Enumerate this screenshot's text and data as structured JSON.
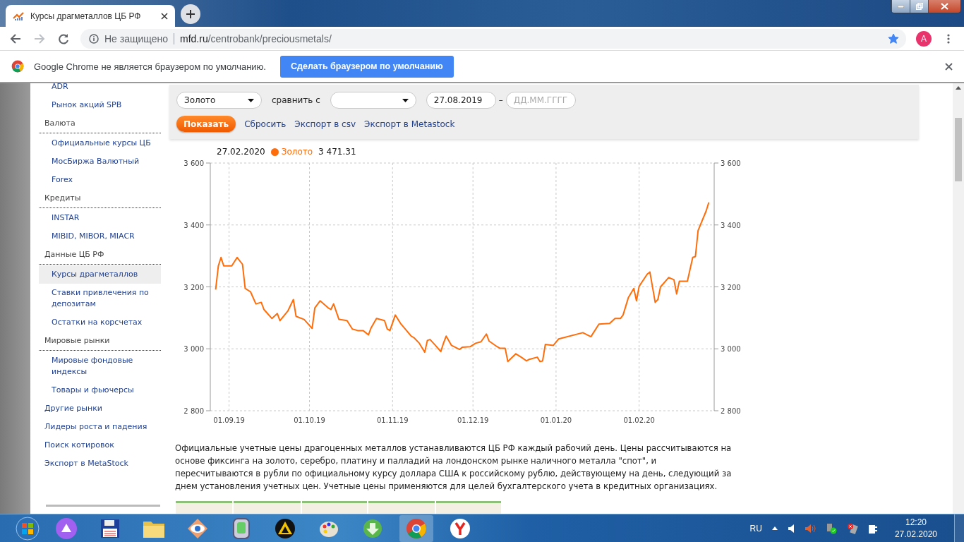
{
  "browser": {
    "tab_title": "Курсы драгметаллов ЦБ РФ",
    "security": "Не защищено",
    "url_host": "mfd.ru",
    "url_path": "/centrobank/preciousmetals/",
    "bookmarked": true,
    "profile_initial": "A"
  },
  "infobar": {
    "message": "Google Chrome не является браузером по умолчанию.",
    "button": "Сделать браузером по умолчанию"
  },
  "sidebar": {
    "items": [
      {
        "kind": "sub",
        "label": "ADR",
        "selected": false
      },
      {
        "kind": "sub",
        "label": "Рынок акций SPB",
        "selected": false
      },
      {
        "kind": "section",
        "label": "Валюта",
        "selected": false
      },
      {
        "kind": "sub",
        "label": "Официальные курсы ЦБ",
        "selected": false
      },
      {
        "kind": "sub",
        "label": "МосБиржа Валютный",
        "selected": false
      },
      {
        "kind": "sub",
        "label": "Forex",
        "selected": false
      },
      {
        "kind": "section",
        "label": "Кредиты",
        "selected": false
      },
      {
        "kind": "sub",
        "label": "INSTAR",
        "selected": false
      },
      {
        "kind": "sub",
        "label": "MIBID, MIBOR, MIACR",
        "selected": false
      },
      {
        "kind": "section",
        "label": "Данные ЦБ РФ",
        "selected": false
      },
      {
        "kind": "sub",
        "label": "Курсы драгметаллов",
        "selected": true
      },
      {
        "kind": "sub",
        "label": "Ставки привлечения по депозитам",
        "selected": false
      },
      {
        "kind": "sub",
        "label": "Остатки на корсчетах",
        "selected": false
      },
      {
        "kind": "section",
        "label": "Мировые рынки",
        "selected": false
      },
      {
        "kind": "sub",
        "label": "Мировые фондовые индексы",
        "selected": false
      },
      {
        "kind": "sub",
        "label": "Товары и фьючерсы",
        "selected": false
      },
      {
        "kind": "top",
        "label": "Другие рынки",
        "selected": false
      },
      {
        "kind": "top",
        "label": "Лидеры роста и падения",
        "selected": false
      },
      {
        "kind": "top",
        "label": "Поиск котировок",
        "selected": false
      },
      {
        "kind": "top",
        "label": "Экспорт в MetaStock",
        "selected": false
      }
    ]
  },
  "filters": {
    "metal": "Золото",
    "compare_label": "сравнить с",
    "date_from": "27.08.2019",
    "date_separator": "–",
    "date_to_placeholder": "ДД.ММ.ГГГГ",
    "show_button": "Показать",
    "links": [
      "Сбросить",
      "Экспорт в csv",
      "Экспорт в Metastock"
    ]
  },
  "legend": {
    "date": "27.02.2020",
    "value": "3 471.31"
  },
  "chart_data": {
    "type": "line",
    "grid": true,
    "xlim": [
      "2019-08-25",
      "2020-02-29"
    ],
    "ylim": [
      2800,
      3600
    ],
    "y2lim": [
      2800,
      3600
    ],
    "xticks": [
      {
        "value": "2019-09-01",
        "label": "01.09.19"
      },
      {
        "value": "2019-10-01",
        "label": "01.10.19"
      },
      {
        "value": "2019-11-01",
        "label": "01.11.19"
      },
      {
        "value": "2019-12-01",
        "label": "01.12.19"
      },
      {
        "value": "2020-01-01",
        "label": "01.01.20"
      },
      {
        "value": "2020-02-01",
        "label": "01.02.20"
      }
    ],
    "yticks": [
      {
        "value": 2800,
        "label": "2 800"
      },
      {
        "value": 3000,
        "label": "3 000"
      },
      {
        "value": 3200,
        "label": "3 200"
      },
      {
        "value": 3400,
        "label": "3 400"
      },
      {
        "value": 3600,
        "label": "3 600"
      }
    ],
    "y2ticks": [
      {
        "value": 2800,
        "label": "2 800"
      },
      {
        "value": 3000,
        "label": "3 000"
      },
      {
        "value": 3200,
        "label": "3 200"
      },
      {
        "value": 3400,
        "label": "3 400"
      },
      {
        "value": 3600,
        "label": "3 600"
      }
    ],
    "x": [
      "2019-08-27",
      "2019-08-28",
      "2019-08-29",
      "2019-08-30",
      "2019-09-02",
      "2019-09-04",
      "2019-09-06",
      "2019-09-07",
      "2019-09-09",
      "2019-09-11",
      "2019-09-13",
      "2019-09-14",
      "2019-09-17",
      "2019-09-19",
      "2019-09-20",
      "2019-09-23",
      "2019-09-25",
      "2019-09-26",
      "2019-09-29",
      "2019-10-02",
      "2019-10-03",
      "2019-10-05",
      "2019-10-08",
      "2019-10-09",
      "2019-10-10",
      "2019-10-12",
      "2019-10-15",
      "2019-10-17",
      "2019-10-19",
      "2019-10-21",
      "2019-10-23",
      "2019-10-24",
      "2019-10-26",
      "2019-10-29",
      "2019-10-30",
      "2019-10-31",
      "2019-11-02",
      "2019-11-04",
      "2019-11-08",
      "2019-11-09",
      "2019-11-11",
      "2019-11-13",
      "2019-11-14",
      "2019-11-15",
      "2019-11-17",
      "2019-11-19",
      "2019-11-20",
      "2019-11-21",
      "2019-11-23",
      "2019-11-26",
      "2019-11-27",
      "2019-11-30",
      "2019-12-02",
      "2019-12-04",
      "2019-12-06",
      "2019-12-07",
      "2019-12-10",
      "2019-12-11",
      "2019-12-13",
      "2019-12-14",
      "2019-12-17",
      "2019-12-19",
      "2019-12-21",
      "2019-12-22",
      "2019-12-25",
      "2019-12-26",
      "2019-12-27",
      "2019-12-28",
      "2019-12-31",
      "2020-01-02",
      "2020-01-11",
      "2020-01-14",
      "2020-01-17",
      "2020-01-21",
      "2020-01-23",
      "2020-01-25",
      "2020-01-26",
      "2020-01-28",
      "2020-01-30",
      "2020-01-31",
      "2020-02-01",
      "2020-02-04",
      "2020-02-05",
      "2020-02-07",
      "2020-02-08",
      "2020-02-09",
      "2020-02-12",
      "2020-02-14",
      "2020-02-15",
      "2020-02-16",
      "2020-02-18",
      "2020-02-19",
      "2020-02-21",
      "2020-02-22",
      "2020-02-23",
      "2020-02-26",
      "2020-02-27"
    ],
    "series": [
      {
        "name": "Золото",
        "color": "#ff6d0a",
        "values": [
          3191,
          3268,
          3295,
          3268,
          3268,
          3295,
          3273,
          3195,
          3184,
          3145,
          3150,
          3127,
          3098,
          3114,
          3091,
          3123,
          3159,
          3105,
          3095,
          3066,
          3132,
          3155,
          3132,
          3127,
          3145,
          3095,
          3091,
          3064,
          3059,
          3059,
          3045,
          3068,
          3098,
          3091,
          3064,
          3059,
          3109,
          3082,
          3041,
          3036,
          3018,
          2989,
          3027,
          3030,
          3011,
          2991,
          3018,
          3041,
          3011,
          2998,
          3005,
          3007,
          3018,
          3023,
          3048,
          3025,
          3007,
          3002,
          3002,
          2959,
          2984,
          2973,
          2961,
          2966,
          2973,
          2959,
          2961,
          3014,
          3011,
          3032,
          3052,
          3039,
          3080,
          3082,
          3098,
          3098,
          3109,
          3166,
          3195,
          3155,
          3202,
          3241,
          3248,
          3150,
          3159,
          3200,
          3230,
          3223,
          3177,
          3218,
          3218,
          3218,
          3295,
          3298,
          3382,
          3445,
          3473
        ]
      }
    ]
  },
  "description": "Официальные учетные цены драгоценных металлов устанавливаются ЦБ РФ каждый рабочий день. Цены рассчитываются на основе фиксинга на золото, серебро, платину и палладий на лондонском рынке наличного металла \"спот\", и пересчитываются в рубли по официальному курсу доллара США к российскому рублю, действующему на день, следующий за днем установления учетных цен. Учетные цены применяются для целей бухгалтерского учета в кредитных организациях.",
  "taskbar": {
    "language": "RU",
    "time": "12:20",
    "date": "27.02.2020"
  }
}
